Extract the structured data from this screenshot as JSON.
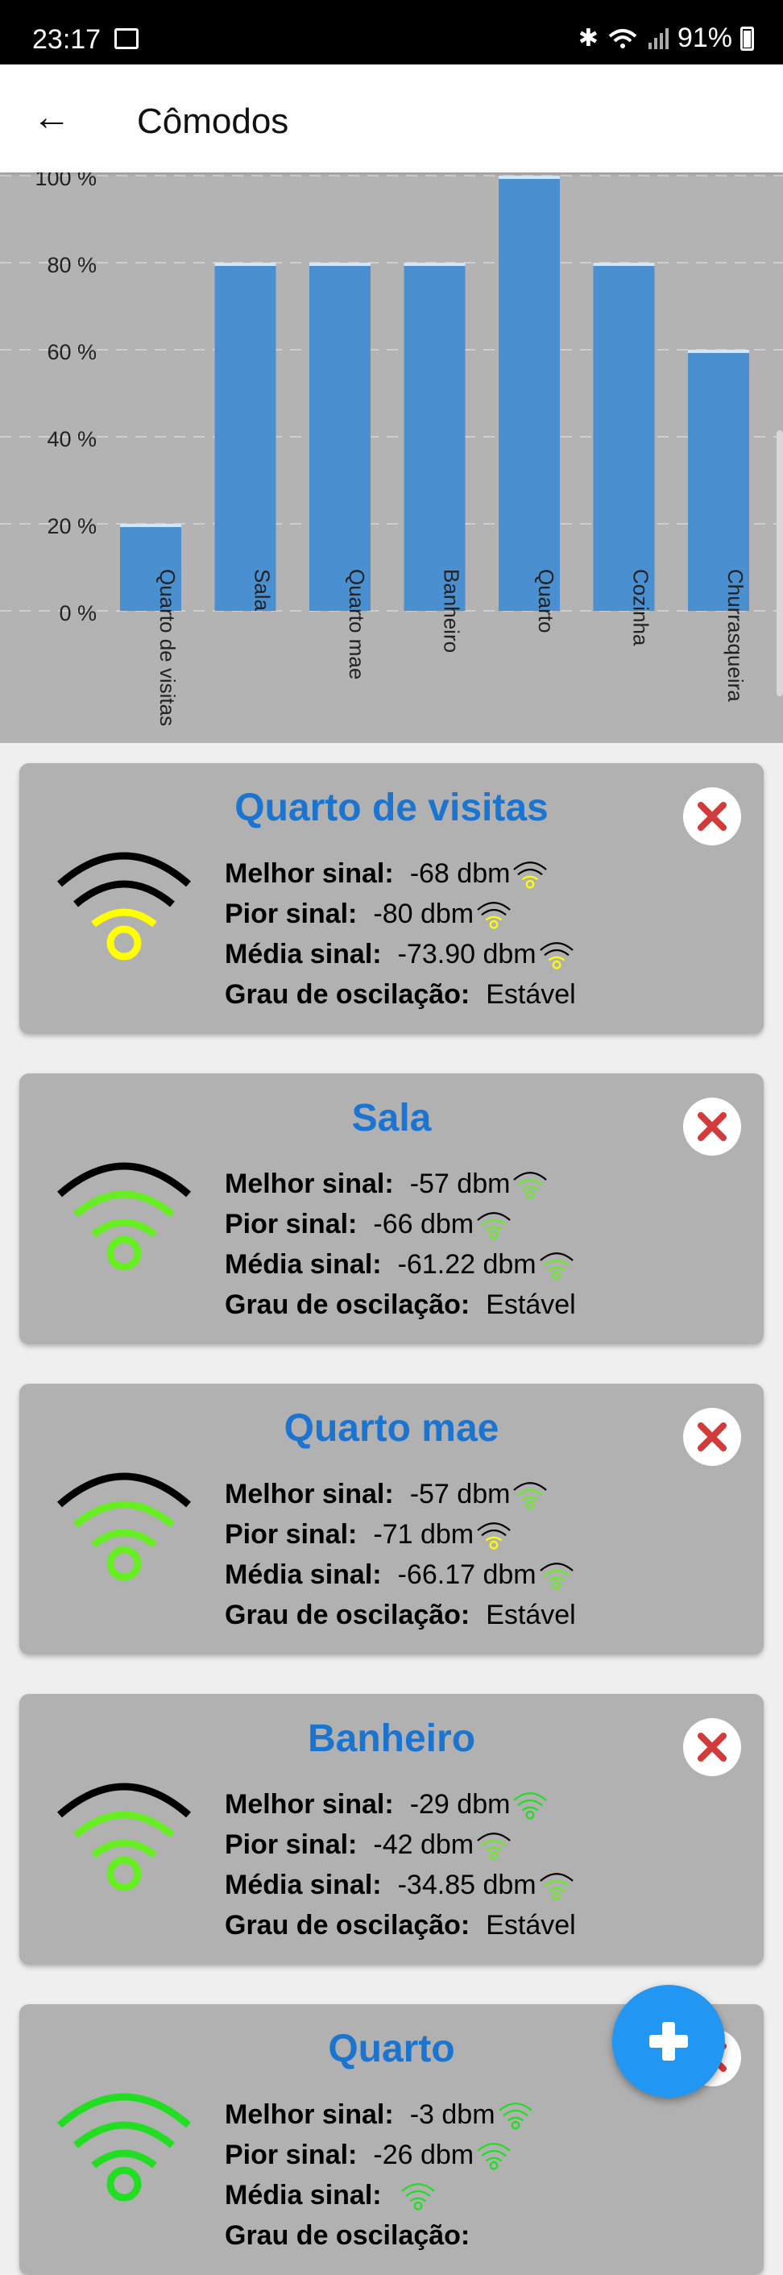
{
  "status_bar": {
    "time": "23:17",
    "battery": "91%"
  },
  "app_bar": {
    "title": "Cômodos",
    "back_icon": "arrow-back-icon"
  },
  "chart_data": {
    "type": "bar",
    "categories": [
      "Quarto de visitas",
      "Sala",
      "Quarto mae",
      "Banheiro",
      "Quarto",
      "Cozinha",
      "Churrasqueira"
    ],
    "values": [
      20,
      80,
      80,
      80,
      100,
      80,
      60
    ],
    "y_tick_labels": [
      "0 %",
      "20 %",
      "40 %",
      "60 %",
      "80 %",
      "100 %"
    ],
    "ylim": [
      0,
      100
    ],
    "grid": true,
    "bar_color": "#4a8fd0"
  },
  "labels": {
    "best": "Melhor sinal:",
    "worst": "Pior sinal:",
    "average": "Média sinal:",
    "oscillation": "Grau de oscilação:"
  },
  "rooms": [
    {
      "name": "Quarto de visitas",
      "best": "-68 dbm",
      "worst": "-80 dbm",
      "average": "-73.90 dbm",
      "oscillation": "Estável",
      "level": 1,
      "best_level": 1,
      "worst_level": 1,
      "avg_level": 1
    },
    {
      "name": "Sala",
      "best": "-57 dbm",
      "worst": "-66 dbm",
      "average": "-61.22 dbm",
      "oscillation": "Estável",
      "level": 3,
      "best_level": 3,
      "worst_level": 3,
      "avg_level": 3
    },
    {
      "name": "Quarto mae",
      "best": "-57 dbm",
      "worst": "-71 dbm",
      "average": "-66.17 dbm",
      "oscillation": "Estável",
      "level": 3,
      "best_level": 3,
      "worst_level": 1,
      "avg_level": 3
    },
    {
      "name": "Banheiro",
      "best": "-29 dbm",
      "worst": "-42 dbm",
      "average": "-34.85 dbm",
      "oscillation": "Estável",
      "level": 3,
      "best_level": 4,
      "worst_level": 3,
      "avg_level": 3
    },
    {
      "name": "Quarto",
      "best": "-3 dbm",
      "worst": "-26 dbm",
      "average": "",
      "oscillation": "",
      "level": 4,
      "best_level": 4,
      "worst_level": 4,
      "avg_level": 4
    }
  ],
  "colors": {
    "weak": "#ffff00",
    "good": "#66ee22",
    "strong": "#22dd22",
    "title": "#1b74d0",
    "delete": "#d33b3b",
    "fab": "#2196f3"
  },
  "fab": {
    "icon": "plus-icon"
  }
}
